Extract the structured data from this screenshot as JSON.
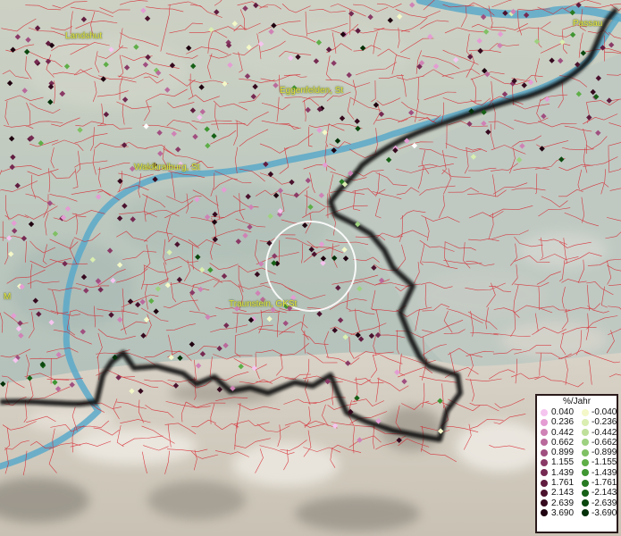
{
  "cities": [
    {
      "id": "landshut",
      "label": "Landshut"
    },
    {
      "id": "passau",
      "label": "Passau"
    },
    {
      "id": "eggenfelden",
      "label": "Eggenfelden, St"
    },
    {
      "id": "waldkraiburg",
      "label": "Waldkraiburg, St"
    },
    {
      "id": "traunstein",
      "label": "Traunstein, GKSt"
    },
    {
      "id": "edge_m",
      "label": "M"
    }
  ],
  "legend": {
    "title": "%/Jahr",
    "rows": [
      {
        "pos": "0.040",
        "pos_color": "#f5c4ef",
        "neg": "-0.040",
        "neg_color": "#f4f8c8"
      },
      {
        "pos": "0.236",
        "pos_color": "#e49cd3",
        "neg": "-0.236",
        "neg_color": "#d9eeb0"
      },
      {
        "pos": "0.442",
        "pos_color": "#cf82b5",
        "neg": "-0.442",
        "neg_color": "#bfe09b"
      },
      {
        "pos": "0.662",
        "pos_color": "#b9699b",
        "neg": "-0.662",
        "neg_color": "#9ed180"
      },
      {
        "pos": "0.899",
        "pos_color": "#a04f80",
        "neg": "-0.899",
        "neg_color": "#7fc064"
      },
      {
        "pos": "1.155",
        "pos_color": "#8a3a66",
        "neg": "-1.155",
        "neg_color": "#5fae48"
      },
      {
        "pos": "1.439",
        "pos_color": "#762a52",
        "neg": "-1.439",
        "neg_color": "#3f9632"
      },
      {
        "pos": "1.761",
        "pos_color": "#611d40",
        "neg": "-1.761",
        "neg_color": "#287a22"
      },
      {
        "pos": "2.143",
        "pos_color": "#4b122e",
        "neg": "-2.143",
        "neg_color": "#176017"
      },
      {
        "pos": "2.639",
        "pos_color": "#360a1f",
        "neg": "-2.639",
        "neg_color": "#0b470e"
      },
      {
        "pos": "3.690",
        "pos_color": "#1f0310",
        "neg": "-3.690",
        "neg_color": "#033008"
      }
    ]
  }
}
